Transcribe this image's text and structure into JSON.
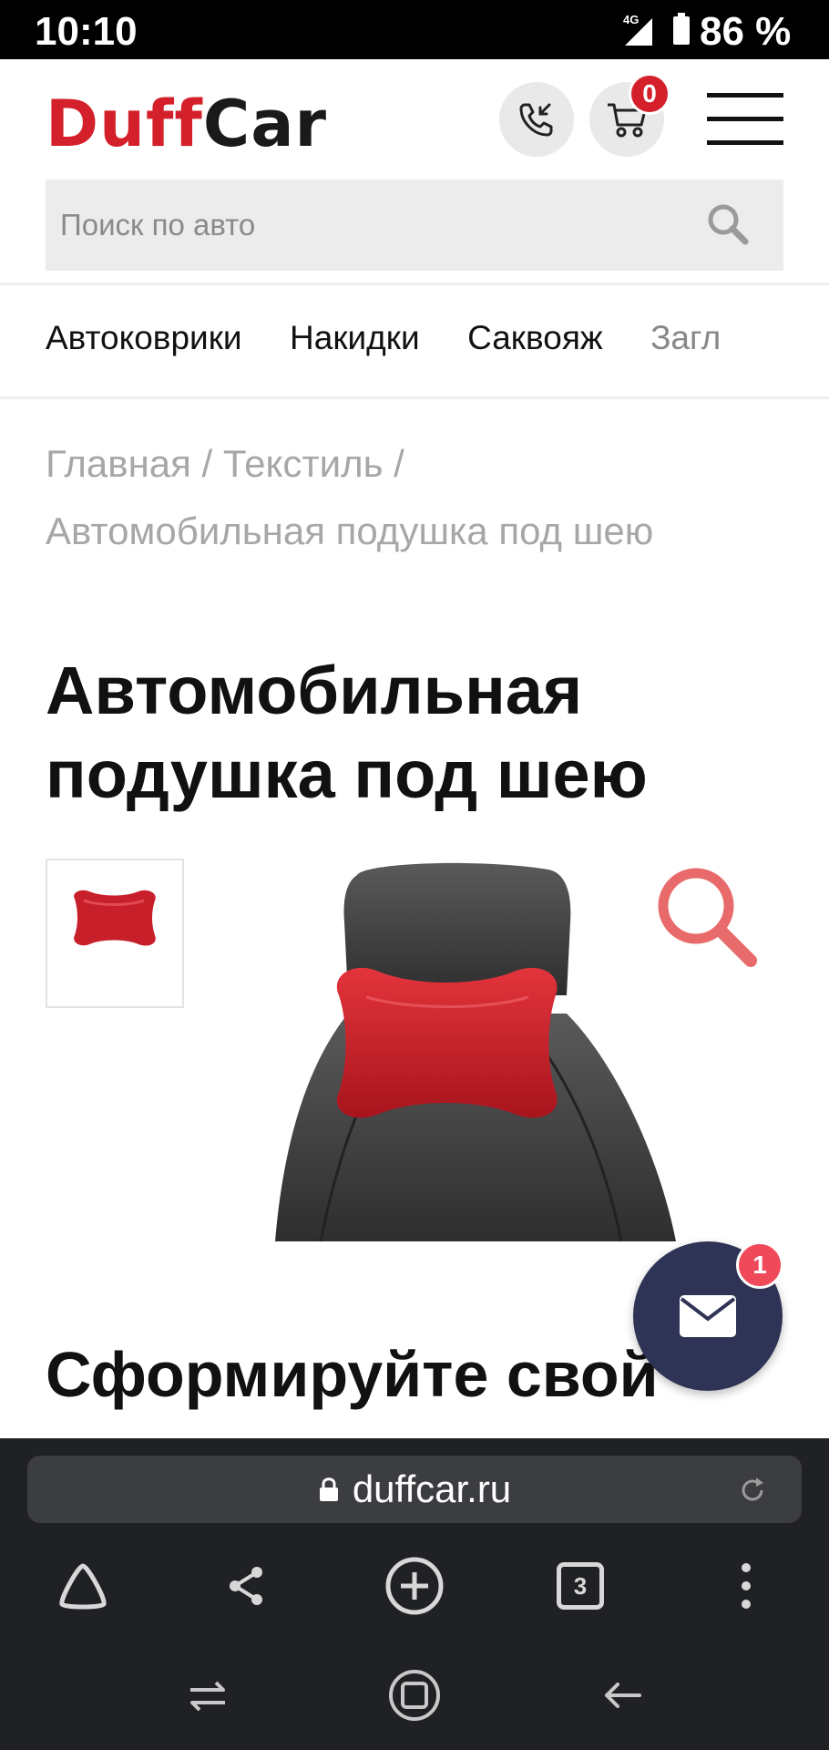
{
  "status_bar": {
    "time": "10:10",
    "network": "4G",
    "battery": "86 %"
  },
  "header": {
    "logo_part1": "Duff",
    "logo_part2": "Car",
    "cart_count": "0"
  },
  "search": {
    "placeholder": "Поиск по авто"
  },
  "categories": [
    "Автоковрики",
    "Накидки",
    "Саквояж",
    "Загл"
  ],
  "breadcrumb": {
    "home": "Главная",
    "section": "Текстиль",
    "current": "Автомобильная подушка под шею",
    "separator": "/"
  },
  "product": {
    "title": "Автомобильная подушка под шею"
  },
  "section_heading": "Сформируйте свой",
  "chat": {
    "badge": "1"
  },
  "browser": {
    "url": "duffcar.ru",
    "tab_count": "3"
  },
  "colors": {
    "brand_red": "#d4202a",
    "chat_bg": "#2f3457",
    "badge_red": "#f04a5a"
  },
  "icons": [
    "phone-icon",
    "cart-icon",
    "menu-icon",
    "search-icon",
    "zoom-icon",
    "mail-icon",
    "lock-icon",
    "reload-icon",
    "home-icon",
    "share-icon",
    "new-tab-icon",
    "tabs-icon",
    "more-icon",
    "recent-apps-icon",
    "home-nav-icon",
    "back-icon"
  ]
}
